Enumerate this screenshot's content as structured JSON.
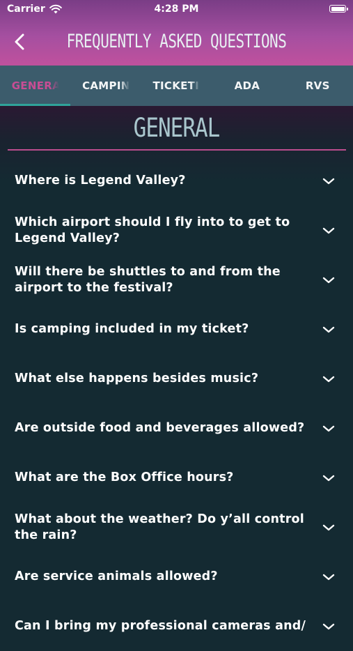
{
  "status_bar": {
    "carrier": "Carrier",
    "time": "4:28 PM"
  },
  "nav": {
    "title": "FREQUENTLY ASKED QUESTIONS"
  },
  "tabs": [
    {
      "label": "GENERAL",
      "active": true
    },
    {
      "label": "CAMPING"
    },
    {
      "label": "TICKETING"
    },
    {
      "label": "ADA"
    },
    {
      "label": "RVS"
    }
  ],
  "section": {
    "title": "GENERAL"
  },
  "faqs": [
    "Where is Legend Valley?",
    "Which airport should I fly into to get to Legend Valley?",
    "Will there be shuttles to and from the airport to the festival?",
    "Is camping included in my ticket?",
    "What else happens besides music?",
    "Are outside food and beverages allowed?",
    "What are the Box Office hours?",
    "What about the weather? Do y’all control the rain?",
    "Are service animals allowed?",
    "Can I bring my professional cameras and/"
  ],
  "colors": {
    "header_gradient_top": "#7a3d86",
    "header_gradient_bottom": "#c0519d",
    "tab_bar": "#3c5c6c",
    "active_tab_text": "#c84d94",
    "active_tab_indicator": "#2fa39a",
    "divider": "#bb4d8d",
    "background": "#142a32"
  },
  "icons": {
    "back": "chevron-left-icon",
    "expand": "chevron-down-icon",
    "wifi": "wifi-icon",
    "battery": "battery-icon"
  }
}
